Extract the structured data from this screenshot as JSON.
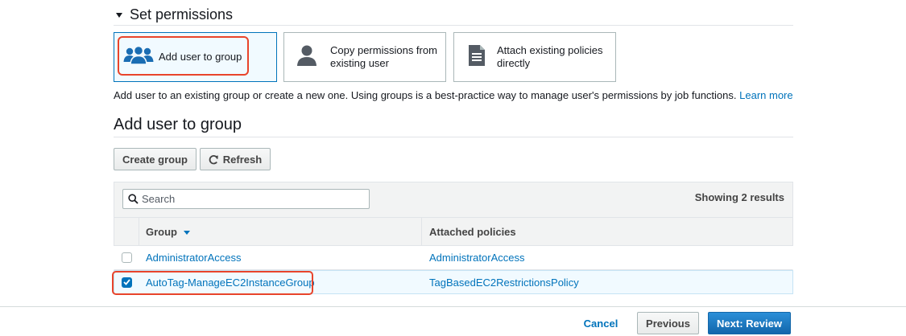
{
  "permissions": {
    "title": "Set permissions",
    "options": [
      {
        "label": "Add user to group",
        "selected": true,
        "icon": "user-group-icon"
      },
      {
        "label": "Copy permissions from existing user",
        "selected": false,
        "icon": "user-icon"
      },
      {
        "label": "Attach existing policies directly",
        "selected": false,
        "icon": "document-icon"
      }
    ]
  },
  "help": {
    "text": "Add user to an existing group or create a new one. Using groups is a best-practice way to manage user's permissions by job functions.",
    "link": "Learn more"
  },
  "group_section": {
    "title": "Add user to group",
    "create_button": "Create group",
    "refresh_button": "Refresh"
  },
  "table": {
    "search_placeholder": "Search",
    "results_text": "Showing 2 results",
    "columns": {
      "group": "Group",
      "policies": "Attached policies"
    },
    "rows": [
      {
        "group": "AdministratorAccess",
        "policy": "AdministratorAccess",
        "checked": false
      },
      {
        "group": "AutoTag-ManageEC2InstanceGroup",
        "policy": "TagBasedEC2RestrictionsPolicy",
        "checked": true
      }
    ]
  },
  "footer": {
    "cancel": "Cancel",
    "previous": "Previous",
    "next": "Next: Review"
  },
  "colors": {
    "link": "#0073bb",
    "highlight": "#e8442b",
    "selected_bg": "#f1faff",
    "primary_button": "#1266ab"
  }
}
